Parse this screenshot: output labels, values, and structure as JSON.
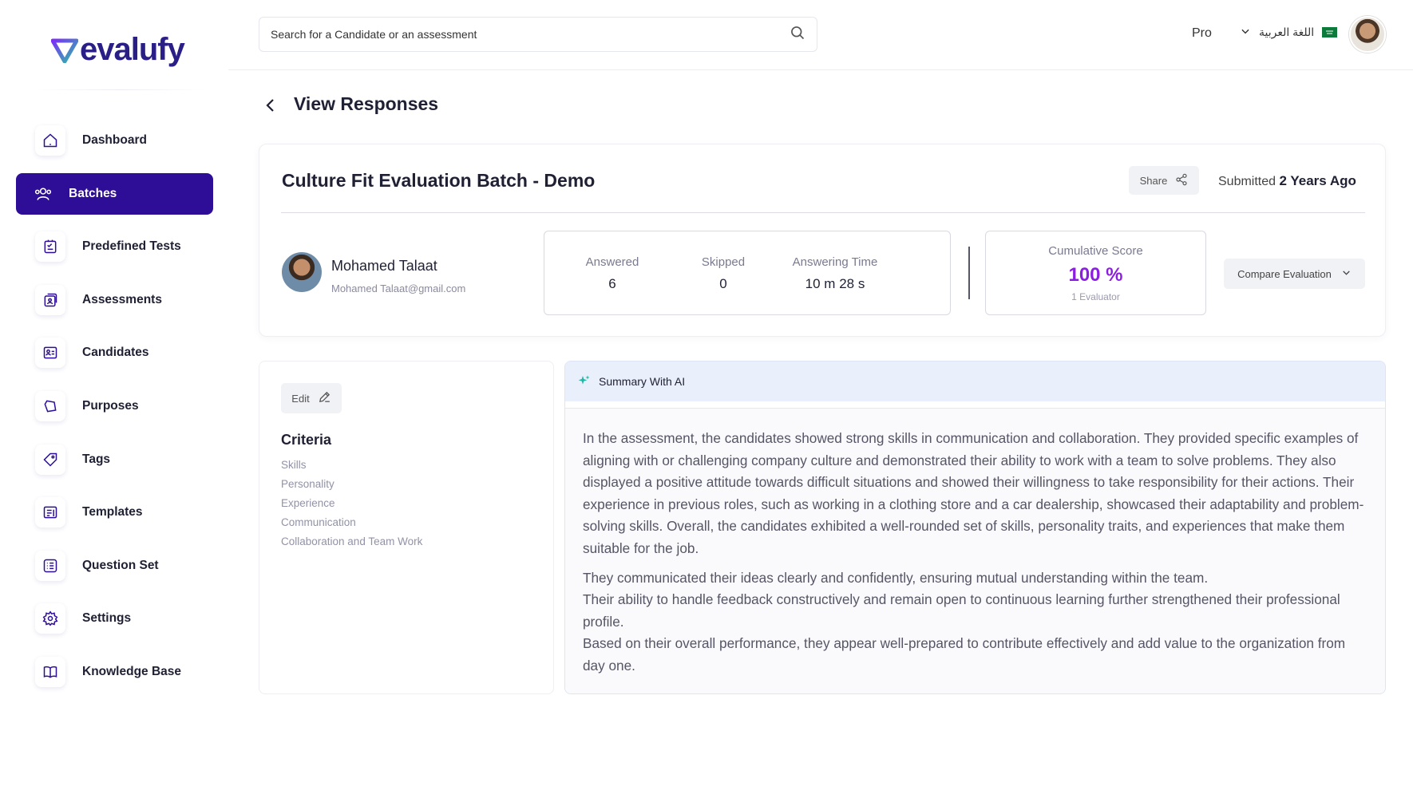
{
  "brand": {
    "name": "evalufy",
    "colors": {
      "primary": "#2e0d97",
      "accent": "#8b1fe0",
      "logo_mark": "#2bbfa4"
    }
  },
  "sidebar": {
    "items": [
      {
        "label": "Dashboard",
        "icon": "home-icon",
        "active": false
      },
      {
        "label": "Batches",
        "icon": "users-icon",
        "active": true
      },
      {
        "label": "Predefined Tests",
        "icon": "checklist-icon",
        "active": false
      },
      {
        "label": "Assessments",
        "icon": "assessment-icon",
        "active": false
      },
      {
        "label": "Candidates",
        "icon": "id-card-icon",
        "active": false
      },
      {
        "label": "Purposes",
        "icon": "purpose-icon",
        "active": false
      },
      {
        "label": "Tags",
        "icon": "tag-icon",
        "active": false
      },
      {
        "label": "Templates",
        "icon": "template-icon",
        "active": false
      },
      {
        "label": "Question Set",
        "icon": "list-icon",
        "active": false
      },
      {
        "label": "Settings",
        "icon": "gear-icon",
        "active": false
      },
      {
        "label": "Knowledge Base",
        "icon": "book-icon",
        "active": false
      }
    ]
  },
  "header": {
    "search_placeholder": "Search for a Candidate or an assessment",
    "plan": "Pro",
    "language": "اللغة العربية"
  },
  "page": {
    "title": "View Responses"
  },
  "batch": {
    "title": "Culture Fit Evaluation Batch - Demo",
    "share_label": "Share",
    "submitted_prefix": "Submitted",
    "submitted_value": "2 Years Ago",
    "candidate": {
      "name": "Mohamed Talaat",
      "email": "Mohamed Talaat@gmail.com"
    },
    "stats": [
      {
        "label": "Answered",
        "value": "6"
      },
      {
        "label": "Skipped",
        "value": "0"
      },
      {
        "label": "Answering Time",
        "value": "10 m 28 s"
      }
    ],
    "score": {
      "label": "Cumulative Score",
      "value": "100 %",
      "evaluators": "1 Evaluator"
    },
    "compare_label": "Compare Evaluation"
  },
  "criteria": {
    "edit_label": "Edit",
    "title": "Criteria",
    "items": [
      "Skills",
      "Personality",
      "Experience",
      "Communication",
      "Collaboration and Team Work"
    ]
  },
  "ai_summary": {
    "title": "Summary With AI",
    "paragraph1": "In the assessment, the candidates showed strong skills in communication and collaboration. They provided specific examples of aligning with or challenging company culture and demonstrated their ability to work with a team to solve problems. They also displayed a positive attitude towards difficult situations and showed their willingness to take responsibility for their actions. Their experience in previous roles, such as working in a clothing store and a car dealership, showcased their adaptability and problem-solving skills. Overall, the candidates exhibited a well-rounded set of skills, personality traits, and experiences that make them suitable for the job.",
    "paragraph2_line1": "They communicated their ideas clearly and confidently, ensuring mutual understanding within the team.",
    "paragraph2_line2": "Their ability to handle feedback constructively and remain open to continuous learning further strengthened their professional profile.",
    "paragraph2_line3": "Based on their overall performance, they appear well-prepared to contribute effectively and add value to the organization from day one."
  }
}
